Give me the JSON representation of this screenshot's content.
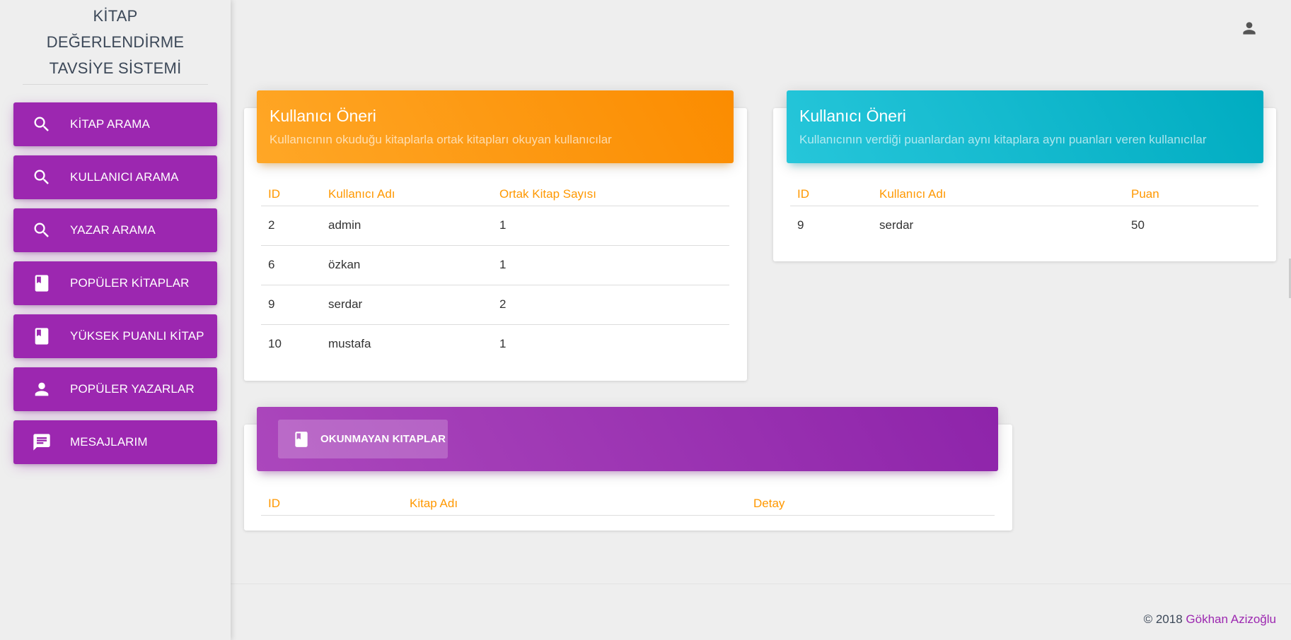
{
  "brand": {
    "title": "KİTAP DEĞERLENDİRME TAVSİYE SİSTEMİ"
  },
  "sidebar": {
    "items": [
      {
        "label": "KİTAP ARAMA",
        "icon": "search-icon"
      },
      {
        "label": "KULLANICI ARAMA",
        "icon": "search-icon"
      },
      {
        "label": "YAZAR ARAMA",
        "icon": "search-icon"
      },
      {
        "label": "POPÜLER KİTAPLAR",
        "icon": "book-icon"
      },
      {
        "label": "YÜKSEK PUANLI KİTAP",
        "icon": "book-icon"
      },
      {
        "label": "POPÜLER YAZARLAR",
        "icon": "person-icon"
      },
      {
        "label": "MESAJLARIM",
        "icon": "message-icon"
      }
    ],
    "accent": "#9c27b0"
  },
  "header": {
    "user_icon": "person-icon"
  },
  "card_common": {
    "title": "Kullanıcı Öneri",
    "subtitle": "Kullanıcının okuduğu kitaplarla ortak kitapları okuyan kullanıcılar",
    "columns": [
      "ID",
      "Kullanıcı Adı",
      "Ortak Kitap Sayısı"
    ],
    "rows": [
      [
        "2",
        "admin",
        "1"
      ],
      [
        "6",
        "özkan",
        "1"
      ],
      [
        "9",
        "serdar",
        "2"
      ],
      [
        "10",
        "mustafa",
        "1"
      ]
    ],
    "header_color": "#fb8c00"
  },
  "card_rating": {
    "title": "Kullanıcı Öneri",
    "subtitle": "Kullanıcının verdiği puanlardan aynı kitaplara aynı puanları veren kullanıcılar",
    "columns": [
      "ID",
      "Kullanıcı Adı",
      "Puan"
    ],
    "rows": [
      [
        "9",
        "serdar",
        "50"
      ]
    ],
    "header_color": "#00acc1"
  },
  "card_unread": {
    "tab_label": "OKUNMAYAN KITAPLAR",
    "tab_icon": "book-icon",
    "columns": [
      "ID",
      "Kitap Adı",
      "Detay"
    ],
    "header_color": "#8e24aa"
  },
  "footer": {
    "prefix": "© 2018",
    "author": "Gökhan Azizoğlu"
  }
}
